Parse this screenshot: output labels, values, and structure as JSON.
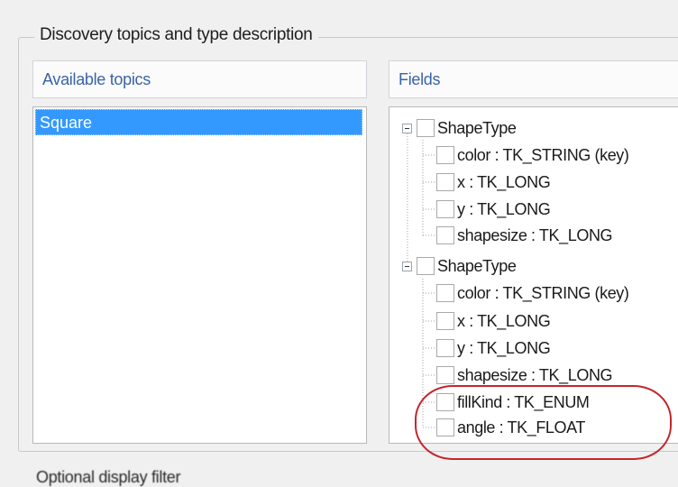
{
  "group": {
    "title": "Discovery topics and type description"
  },
  "topics": {
    "header": "Available topics",
    "items": [
      "Square"
    ]
  },
  "fields": {
    "header": "Fields",
    "nodes": [
      {
        "label": "ShapeType",
        "level": 0
      },
      {
        "label": "color : TK_STRING (key)",
        "level": 1
      },
      {
        "label": "x : TK_LONG",
        "level": 1
      },
      {
        "label": "y : TK_LONG",
        "level": 1
      },
      {
        "label": "shapesize : TK_LONG",
        "level": 1
      },
      {
        "label": "ShapeType",
        "level": 0
      },
      {
        "label": "color : TK_STRING (key)",
        "level": 1
      },
      {
        "label": "x : TK_LONG",
        "level": 1
      },
      {
        "label": "y : TK_LONG",
        "level": 1
      },
      {
        "label": "shapesize : TK_LONG",
        "level": 1
      },
      {
        "label": "fillKind : TK_ENUM",
        "level": 1
      },
      {
        "label": "angle : TK_FLOAT",
        "level": 1
      }
    ]
  },
  "highlight_color": "#c1272d",
  "selection_color": "#3399ff",
  "header_text_color": "#3a63a8",
  "bottom_text": "Optional display filter"
}
